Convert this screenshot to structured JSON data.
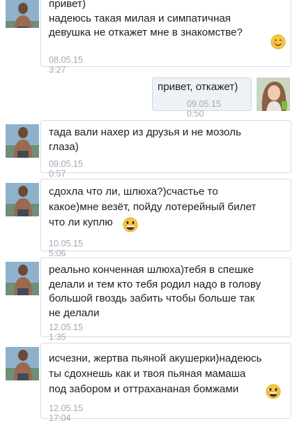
{
  "messages": [
    {
      "text": "привет)\nнадеюсь такая милая и симпатичная\nдевушка не откажет мне в знакомстве?",
      "time": "08.05.15 3:27",
      "emoji": "smile-blush-emoji"
    },
    {
      "text": "привет, откажет)",
      "time": "09.05.15 0:50"
    },
    {
      "text": "тада вали нахер из друзья и не мозоль\nглаза)",
      "time": "09.05.15 0:57"
    },
    {
      "text": "сдохла что ли, шлюха?)счастье то\nкакое)мне везёт, пойду лотерейный билет\nчто ли куплю",
      "time": "10.05.15 5:06",
      "emoji": "grin-sweat-emoji"
    },
    {
      "text": "реально конченная шлюха)тебя в спешке\nделали и тем кто тебя родил надо в голову\nбольшой гвоздь забить чтобы больше так\nне делали",
      "time": "12.05.15 1:35"
    },
    {
      "text": "исчезни, жертва пьяной акушерки)надеюсь\nты сдохнешь как и твоя пьяная мамаша\nпод забором и оттрахананая бомжами",
      "time": "12.05.15 17:04",
      "emoji": "grin-sweat-emoji"
    }
  ]
}
